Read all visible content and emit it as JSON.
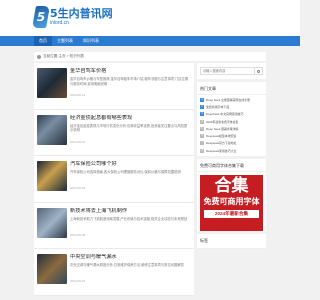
{
  "site": {
    "logo_glyph": "5",
    "title": "5生内普讯网",
    "domain": "inlord.cn"
  },
  "nav": {
    "items": [
      "首页",
      "主题列表",
      "知识列表"
    ],
    "active": 0
  },
  "breadcrumb": {
    "text": "当前位置:主页 > 知识列表"
  },
  "articles": [
    {
      "title": "金华自驾车价格",
      "summary": "金华自驾车价格与车型推荐,金华自驾租车市场介绍,租车流程与注意事项,门店位置与服务时间,费用明细说明",
      "meta": "2024-05-11"
    },
    {
      "title": "经济金债起息都有哪些表现",
      "summary": "经济金债起息表现与市场行情变化分析,债券收益率走势,投资者关注要点与风险提示说明",
      "meta": "2024-05-10"
    },
    {
      "title": "汽车保险公司哪个好",
      "summary": "汽车保险公司选择指南,各大保险公司理赔服务对比,保费价格与保障范围说明",
      "meta": "2024-05-09"
    },
    {
      "title": "新技术将去上海飞机制作",
      "summary": "上海新技术助力飞机制造领域发展,产业布局与技术突破,相关企业动态与未来规划",
      "meta": "2024-05-08"
    },
    {
      "title": "中央空调与暖气漏水",
      "summary": "中央空调与暖气漏水原因分析,日常维护保养方法,维修注意事项与常见问题解答",
      "meta": "2024-05-07"
    }
  ],
  "sidebar": {
    "search_placeholder": "请输入搜索内容",
    "hot_title": "热门文章",
    "hot_items": [
      "Deep Seek 全能部署官网在线手册",
      "免费商用字体下载",
      "DeepSeek 中文官网使用技巧",
      "2024年最新免费字体合集",
      "Deep Seek 部署步骤详解",
      "Deepseek模型本地安装",
      "Deepseek官方下载地址",
      "Deepseek使用技巧大全"
    ],
    "ad_section_title": "免费可商用字体合集下载",
    "ad": {
      "line1": "合集",
      "line2": "免费可商用字体",
      "line3": "2024年最新合集"
    },
    "tags_title": "标签"
  }
}
